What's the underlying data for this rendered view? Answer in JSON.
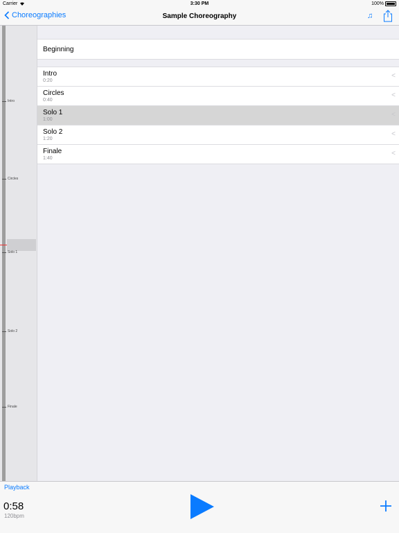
{
  "status_bar": {
    "carrier": "Carrier",
    "time": "3:30 PM",
    "battery": "100%"
  },
  "nav": {
    "back_label": "Choreographies",
    "title": "Sample Choreography"
  },
  "timeline": {
    "labels": [
      "Intro",
      "Circles",
      "Solo 1",
      "Solo 2",
      "Finale"
    ]
  },
  "beginning_label": "Beginning",
  "sections": [
    {
      "name": "Intro",
      "time": "0:20"
    },
    {
      "name": "Circles",
      "time": "0:40"
    },
    {
      "name": "Solo 1",
      "time": "1:00",
      "selected": true
    },
    {
      "name": "Solo 2",
      "time": "1:20"
    },
    {
      "name": "Finale",
      "time": "1:40"
    }
  ],
  "chevron": "<",
  "playback": {
    "label": "Playback",
    "time": "0:58",
    "tempo": "120bpm"
  },
  "colors": {
    "accent": "#0a7bff",
    "selected_row": "#d6d6d6",
    "playhead": "#ee3333"
  },
  "icons": {
    "back": "chevron-left",
    "music": "music-note",
    "share": "share",
    "play": "play-triangle",
    "add": "plus"
  }
}
